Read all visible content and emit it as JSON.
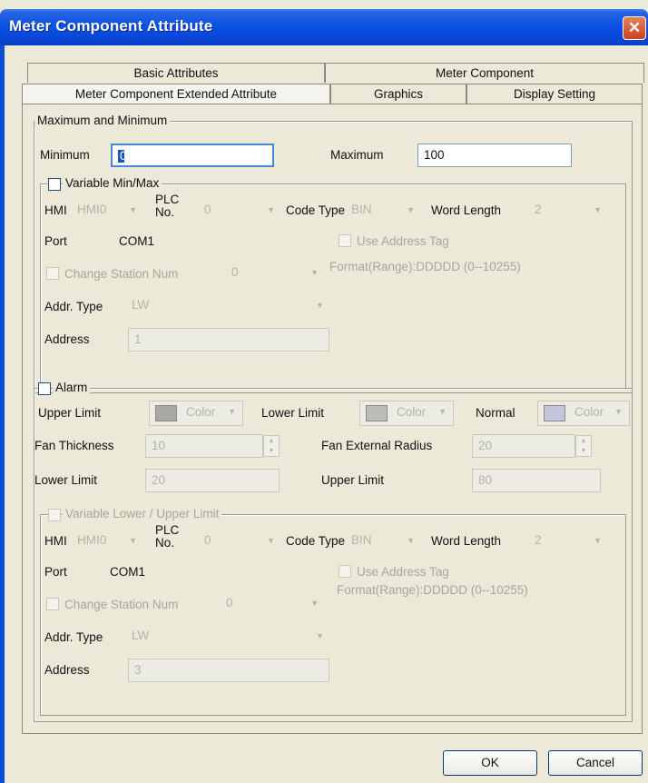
{
  "window": {
    "title": "Meter Component Attribute"
  },
  "tabs": {
    "back_row": [
      "Basic Attributes",
      "Meter Component"
    ],
    "front_row": [
      "Meter Component Extended Attribute",
      "Graphics",
      "Display Setting"
    ]
  },
  "minmax": {
    "legend": "Maximum and Minimum",
    "minimum_label": "Minimum",
    "minimum_value": "0",
    "maximum_label": "Maximum",
    "maximum_value": "100",
    "variable_label": "Variable Min/Max",
    "hmi_label": "HMI",
    "hmi_value": "HMI0",
    "plc_label_line1": "PLC",
    "plc_label_line2": "No.",
    "plc_value": "0",
    "code_type_label": "Code Type",
    "code_type_value": "BIN",
    "word_length_label": "Word Length",
    "word_length_value": "2",
    "port_label": "Port",
    "port_value": "COM1",
    "use_address_tag_label": "Use Address Tag",
    "change_station_label": "Change Station Num",
    "station_value": "0",
    "format_text": "Format(Range):DDDDD (0--10255)",
    "addr_type_label": "Addr. Type",
    "addr_type_value": "LW",
    "address_label": "Address",
    "address_value": "1"
  },
  "alarm": {
    "legend": "Alarm",
    "upper_limit_label": "Upper Limit",
    "lower_limit_color_label": "Lower Limit",
    "normal_label": "Normal",
    "color_label": "Color",
    "fan_thickness_label": "Fan Thickness",
    "fan_thickness_value": "10",
    "fan_radius_label": "Fan External Radius",
    "fan_radius_value": "20",
    "lower_limit_label": "Lower Limit",
    "lower_limit_value": "20",
    "upper_limit_value_label": "Upper Limit",
    "upper_limit_value": "80",
    "variable_label": "Variable Lower / Upper Limit",
    "hmi_label": "HMI",
    "hmi_value": "HMI0",
    "plc_label_line1": "PLC",
    "plc_label_line2": "No.",
    "plc_value": "0",
    "code_type_label": "Code Type",
    "code_type_value": "BIN",
    "word_length_label": "Word Length",
    "word_length_value": "2",
    "port_label": "Port",
    "port_value": "COM1",
    "use_address_tag_label": "Use Address Tag",
    "change_station_label": "Change Station Num",
    "station_value": "0",
    "format_text": "Format(Range):DDDDD (0--10255)",
    "addr_type_label": "Addr. Type",
    "addr_type_value": "LW",
    "address_label": "Address",
    "address_value": "3"
  },
  "buttons": {
    "ok": "OK",
    "cancel": "Cancel"
  },
  "colors": {
    "upper_limit_swatch": "#a9a8a4",
    "lower_limit_swatch": "#bdbcb8",
    "normal_swatch": "#c4c4da"
  }
}
